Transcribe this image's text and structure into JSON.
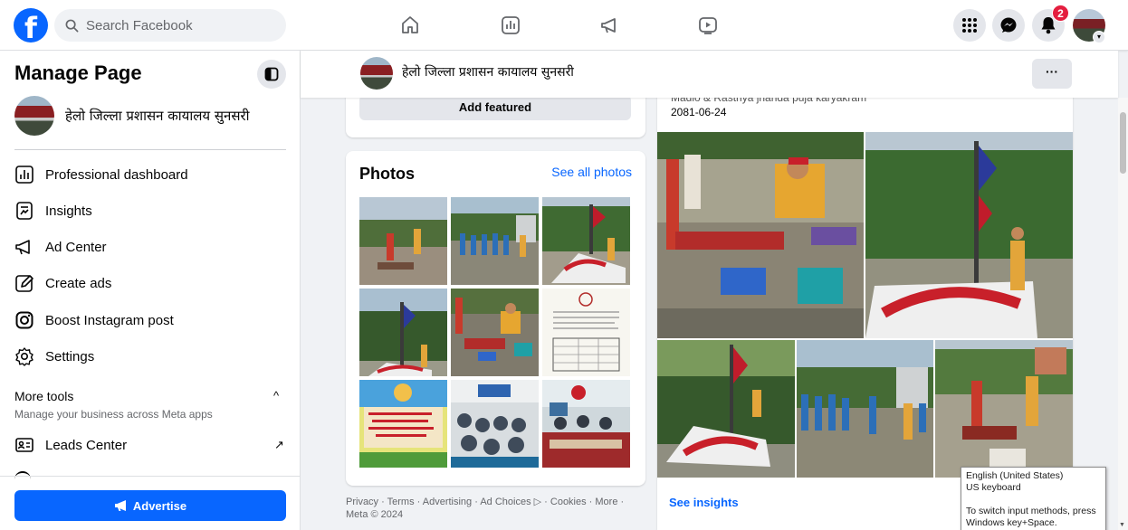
{
  "topbar": {
    "logo_glyph": "f",
    "search_placeholder": "Search Facebook",
    "nav_icons": [
      "home-icon",
      "dashboard-icon",
      "megaphone-icon",
      "video-icon"
    ],
    "right_icons": [
      "menu-grid-icon",
      "messenger-icon",
      "bell-icon"
    ],
    "notification_count": "2",
    "accent_color": "#0866ff"
  },
  "sidebar": {
    "title": "Manage Page",
    "page_name": "हेलो जिल्ला प्रशासन कायालय सुनसरी",
    "items": [
      {
        "label": "Professional dashboard",
        "icon": "dashboard-icon"
      },
      {
        "label": "Insights",
        "icon": "insights-icon"
      },
      {
        "label": "Ad Center",
        "icon": "megaphone-icon"
      },
      {
        "label": "Create ads",
        "icon": "pencil-icon"
      },
      {
        "label": "Boost Instagram post",
        "icon": "instagram-icon"
      },
      {
        "label": "Settings",
        "icon": "gear-icon"
      }
    ],
    "more_tools_title": "More tools",
    "more_tools_subtitle": "Manage your business across Meta apps",
    "more_tools_caret": "^",
    "leads_label": "Leads Center",
    "leads_arrow": "↗",
    "advertise_label": "Advertise"
  },
  "page_header": {
    "name": "हेलो जिल्ला प्रशासन कायालय सुनसरी",
    "more": "···"
  },
  "featured": {
    "button_label": "Add featured"
  },
  "photos": {
    "title": "Photos",
    "see_all": "See all photos"
  },
  "footer": {
    "line1": "Privacy · Terms · Advertising · Ad Choices ▷ · Cookies · More ·",
    "line2": "Meta © 2024"
  },
  "post": {
    "caption": "Madlo & Rastriya jhanda puja karyakram",
    "date": "2081-06-24",
    "insights": "See insights"
  },
  "tooltip": {
    "line1": "English (United States)",
    "line2": "US keyboard",
    "line3": "To switch input methods, press",
    "line4": "Windows key+Space."
  }
}
